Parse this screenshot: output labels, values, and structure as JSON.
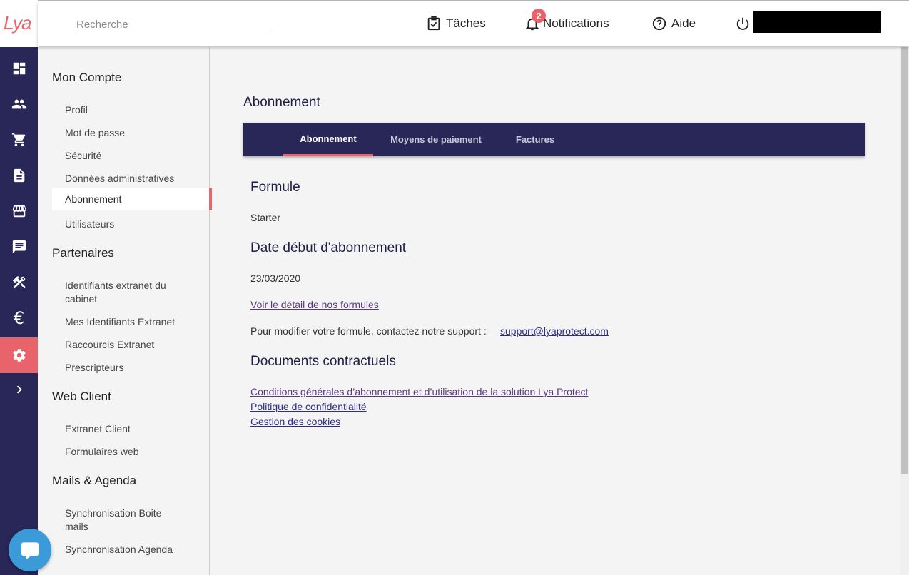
{
  "brand": {
    "logo_text": "Lya",
    "accent": "#e8646a",
    "navy": "#282757"
  },
  "rail": [
    "dashboard-icon",
    "people-icon",
    "cart-icon",
    "document-icon",
    "store-icon",
    "message-icon",
    "tools-icon",
    "euro-icon",
    "gear-icon",
    "chevron-right-icon"
  ],
  "header": {
    "search_placeholder": "Recherche",
    "tasks_label": "Tâches",
    "notifications_label": "Notifications",
    "notifications_count": "2",
    "help_label": "Aide"
  },
  "menu": {
    "sections": [
      {
        "title": "Mon Compte",
        "items": [
          "Profil",
          "Mot de passe",
          "Sécurité",
          "Données administratives",
          "Abonnement",
          "Utilisateurs"
        ]
      },
      {
        "title": "Partenaires",
        "items": [
          "Identifiants extranet du cabinet",
          "Mes Identifiants Extranet",
          "Raccourcis Extranet",
          "Prescripteurs"
        ]
      },
      {
        "title": "Web Client",
        "items": [
          "Extranet Client",
          "Formulaires web"
        ]
      },
      {
        "title": "Mails & Agenda",
        "items": [
          "Synchronisation Boite mails",
          "Synchronisation Agenda"
        ]
      }
    ]
  },
  "main": {
    "title": "Abonnement",
    "tabs": [
      "Abonnement",
      "Moyens de paiement",
      "Factures"
    ],
    "formule_heading": "Formule",
    "formule_value": "Starter",
    "date_heading": "Date début d'abonnement",
    "date_value": "23/03/2020",
    "detail_link": "Voir le détail de nos formules",
    "support_text": "Pour modifier votre formule, contactez notre support :",
    "support_email": "support@lyaprotect.com",
    "docs_heading": "Documents contractuels",
    "docs_links": [
      "Conditions générales d’abonnement et d’utilisation de la solution Lya Protect",
      "Politique de confidentialité",
      "Gestion des cookies"
    ]
  }
}
